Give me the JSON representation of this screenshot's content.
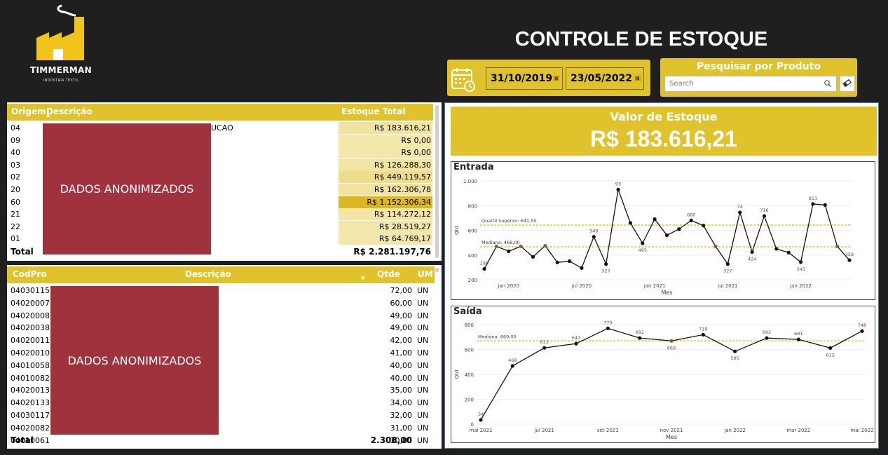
{
  "header": {
    "logo_name": "TIMMERMAN",
    "logo_subtitle": "INDÚSTRIA TEXTIL",
    "title": "CONTROLE DE ESTOQUE"
  },
  "date_filter": {
    "start": "31/10/2019",
    "end": "23/05/2022",
    "icon": "calendar-icon"
  },
  "search": {
    "title": "Pesquisar por Produto",
    "placeholder": "Search"
  },
  "colors": {
    "accent": "#e0c22c",
    "redaction": "#a0323e",
    "background": "#1f1f1f",
    "line": "#111111",
    "reference": "#e8d25a"
  },
  "table_stock": {
    "headers": [
      "Origem",
      "Descrição",
      "Estoque Total"
    ],
    "redaction_label": "DADOS ANONIMIZADOS",
    "partial_text": "UCAO",
    "rows": [
      {
        "origem": "04",
        "valor": "R$ 183.616,21",
        "intensity": 0.2
      },
      {
        "origem": "09",
        "valor": "R$ 0,00",
        "intensity": 0.1
      },
      {
        "origem": "40",
        "valor": "R$ 0,00",
        "intensity": 0.1
      },
      {
        "origem": "03",
        "valor": "R$ 126.288,30",
        "intensity": 0.18
      },
      {
        "origem": "02",
        "valor": "R$ 449.119,57",
        "intensity": 0.45
      },
      {
        "origem": "20",
        "valor": "R$ 162.306,78",
        "intensity": 0.2
      },
      {
        "origem": "60",
        "valor": "R$ 1.152.306,34",
        "intensity": 1.0
      },
      {
        "origem": "21",
        "valor": "R$ 114.272,12",
        "intensity": 0.17
      },
      {
        "origem": "22",
        "valor": "R$ 28.519,27",
        "intensity": 0.12
      },
      {
        "origem": "01",
        "valor": "R$ 64.769,17",
        "intensity": 0.14
      }
    ],
    "total_label": "Total",
    "total_value": "R$ 2.281.197,76"
  },
  "table_products": {
    "headers": [
      "CodPro",
      "Descrição",
      "Qtde",
      "UM"
    ],
    "redaction_label": "DADOS ANONIMIZADOS",
    "rows": [
      {
        "cod": "04030115",
        "qtde": "72,00",
        "um": "UN"
      },
      {
        "cod": "04020007",
        "qtde": "60,00",
        "um": "UN"
      },
      {
        "cod": "04020008",
        "qtde": "49,00",
        "um": "UN"
      },
      {
        "cod": "04020038",
        "qtde": "49,00",
        "um": "UN"
      },
      {
        "cod": "04020011",
        "qtde": "42,00",
        "um": "UN"
      },
      {
        "cod": "04020010",
        "qtde": "41,00",
        "um": "UN"
      },
      {
        "cod": "04010058",
        "qtde": "40,00",
        "um": "UN"
      },
      {
        "cod": "04010082",
        "qtde": "40,00",
        "um": "UN"
      },
      {
        "cod": "04020013",
        "qtde": "35,00",
        "um": "UN"
      },
      {
        "cod": "04020133",
        "qtde": "34,00",
        "um": "UN"
      },
      {
        "cod": "04030117",
        "qtde": "32,00",
        "um": "UN"
      },
      {
        "cod": "04020082",
        "qtde": "31,00",
        "um": "UN"
      },
      {
        "cod": "04010061",
        "qtde": "30,00",
        "um": "UN"
      }
    ],
    "total_label": "Total",
    "total_value": "2.308,00"
  },
  "kpi": {
    "label": "Valor de Estoque",
    "value": "R$ 183.616,21"
  },
  "chart_data": [
    {
      "type": "line",
      "title": "Entrada",
      "xlabel": "Mes",
      "ylabel": "Qtd",
      "ylim": [
        200,
        1000
      ],
      "yticks": [
        200,
        400,
        600,
        800,
        1000
      ],
      "ytick_labels": [
        "200",
        "400",
        "600",
        "800",
        "1.000"
      ],
      "xticks": [
        {
          "label": "jan 2020",
          "i": 2
        },
        {
          "label": "jul 2020",
          "i": 8
        },
        {
          "label": "jan 2021",
          "i": 14
        },
        {
          "label": "jul 2021",
          "i": 20
        },
        {
          "label": "jan 2022",
          "i": 26
        }
      ],
      "values": [
        288,
        470,
        430,
        470,
        385,
        475,
        340,
        350,
        295,
        548,
        327,
        930,
        660,
        495,
        690,
        560,
        610,
        680,
        638,
        470,
        327,
        745,
        424,
        716,
        450,
        420,
        343,
        813,
        805,
        470,
        358
      ],
      "point_labels": [
        {
          "i": 0,
          "text": "288"
        },
        {
          "i": 9,
          "text": "548"
        },
        {
          "i": 10,
          "text": "327"
        },
        {
          "i": 11,
          "text": "93"
        },
        {
          "i": 13,
          "text": "495"
        },
        {
          "i": 17,
          "text": "680"
        },
        {
          "i": 20,
          "text": "327"
        },
        {
          "i": 21,
          "text": "74"
        },
        {
          "i": 22,
          "text": "424"
        },
        {
          "i": 23,
          "text": "716"
        },
        {
          "i": 26,
          "text": "343"
        },
        {
          "i": 27,
          "text": "813"
        },
        {
          "i": 30,
          "text": "358"
        }
      ],
      "reference_lines": [
        {
          "label": "Quartil Superior: 641,50",
          "value": 641.5
        },
        {
          "label": "Mediana: 466,00",
          "value": 466
        }
      ]
    },
    {
      "type": "line",
      "title": "Saída",
      "xlabel": "Mes",
      "ylabel": "Qtd",
      "ylim": [
        0,
        800
      ],
      "yticks": [
        0,
        200,
        400,
        600,
        800
      ],
      "ytick_labels": [
        "0",
        "200",
        "400",
        "600",
        "800"
      ],
      "xticks": [
        {
          "label": "mai 2021",
          "i": 0
        },
        {
          "label": "jul 2021",
          "i": 2
        },
        {
          "label": "set 2021",
          "i": 4
        },
        {
          "label": "nov 2021",
          "i": 6
        },
        {
          "label": "jan 2022",
          "i": 8
        },
        {
          "label": "mar 2022",
          "i": 10
        },
        {
          "label": "mai 2022",
          "i": 12
        }
      ],
      "values": [
        34,
        468,
        613,
        647,
        770,
        692,
        669,
        719,
        585,
        692,
        681,
        612,
        748
      ],
      "point_labels": [
        {
          "i": 0,
          "text": "34"
        },
        {
          "i": 1,
          "text": "468"
        },
        {
          "i": 2,
          "text": "613"
        },
        {
          "i": 3,
          "text": "647"
        },
        {
          "i": 4,
          "text": "770"
        },
        {
          "i": 5,
          "text": "692"
        },
        {
          "i": 6,
          "text": "669"
        },
        {
          "i": 7,
          "text": "719"
        },
        {
          "i": 8,
          "text": "585"
        },
        {
          "i": 9,
          "text": "692"
        },
        {
          "i": 10,
          "text": "681"
        },
        {
          "i": 11,
          "text": "612"
        },
        {
          "i": 12,
          "text": "748"
        }
      ],
      "reference_lines": [
        {
          "label": "Mediana: 669,00",
          "value": 669
        }
      ]
    }
  ]
}
